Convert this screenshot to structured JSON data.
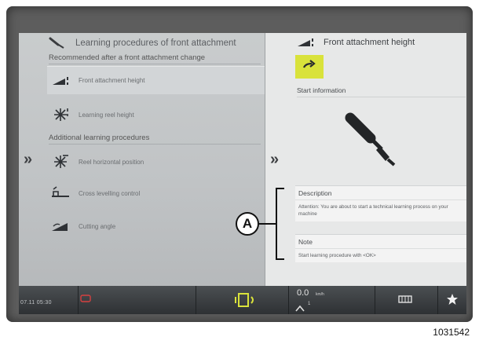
{
  "left_pane": {
    "title": "Learning procedures of front attachment",
    "subtitle": "Recommended after a front attachment change",
    "section_label": "Additional learning procedures",
    "items": [
      {
        "label": "Front attachment height",
        "icon": "attachment-height-icon"
      },
      {
        "label": "Learning reel height",
        "icon": "reel-icon"
      },
      {
        "label": "Reel horizontal position",
        "icon": "reel-icon"
      },
      {
        "label": "Cross levelling control",
        "icon": "cross-levelling-icon"
      },
      {
        "label": "Cutting angle",
        "icon": "cutting-angle-icon"
      }
    ]
  },
  "right_pane": {
    "title": "Front attachment height",
    "go_icon": "arrow-right-icon",
    "start_label": "Start information",
    "description_label": "Description",
    "description_text": "Attention: You are about to start a technical learning process on your machine",
    "note_label": "Note",
    "note_text": "Start learning procedure with <OK>"
  },
  "status_bar": {
    "time": "07.11 05:30",
    "speed": "0.0",
    "speed_unit": "km/h",
    "gear": "1"
  },
  "callout": {
    "letter": "A"
  },
  "figure_number": "1031542",
  "colors": {
    "accent": "#d9e23b",
    "frame": "#5d5d5d",
    "status": "#35393c"
  }
}
